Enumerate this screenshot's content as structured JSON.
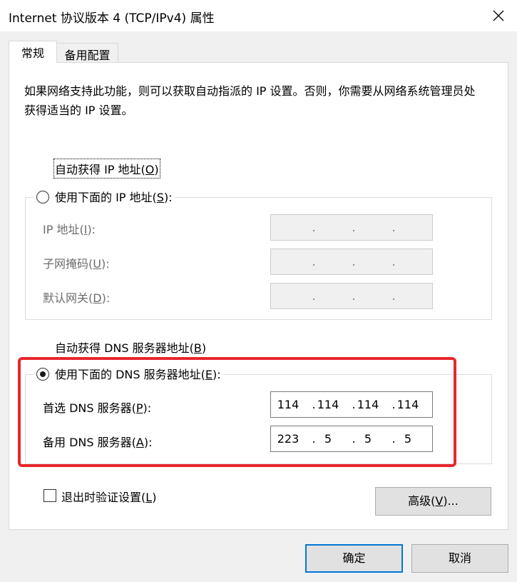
{
  "window": {
    "title": "Internet 协议版本 4 (TCP/IPv4) 属性"
  },
  "tabs": [
    {
      "label": "常规",
      "active": true
    },
    {
      "label": "备用配置",
      "active": false
    }
  ],
  "description": "如果网络支持此功能，则可以获取自动指派的 IP 设置。否则，你需要从网络系统管理员处获得适当的 IP 设置。",
  "ip_section": {
    "auto_option": {
      "label": "自动获得 IP 地址",
      "key": "O",
      "checked": true
    },
    "manual_option": {
      "label": "使用下面的 IP 地址",
      "key": "S",
      "checked": false
    },
    "fields": [
      {
        "label": "IP 地址",
        "key": "I",
        "segments": [
          "",
          "",
          "",
          ""
        ],
        "enabled": false
      },
      {
        "label": "子网掩码",
        "key": "U",
        "segments": [
          "",
          "",
          "",
          ""
        ],
        "enabled": false
      },
      {
        "label": "默认网关",
        "key": "D",
        "segments": [
          "",
          "",
          "",
          ""
        ],
        "enabled": false
      }
    ]
  },
  "dns_section": {
    "auto_option": {
      "label": "自动获得 DNS 服务器地址",
      "key": "B",
      "checked": false
    },
    "manual_option": {
      "label": "使用下面的 DNS 服务器地址",
      "key": "E",
      "checked": true
    },
    "fields": [
      {
        "label": "首选 DNS 服务器",
        "key": "P",
        "segments": [
          "114",
          "114",
          "114",
          "114"
        ],
        "enabled": true
      },
      {
        "label": "备用 DNS 服务器",
        "key": "A",
        "segments": [
          "223",
          "5",
          "5",
          "5"
        ],
        "enabled": true
      }
    ]
  },
  "validate_on_exit": {
    "label": "退出时验证设置",
    "key": "L",
    "checked": false
  },
  "buttons": {
    "advanced": {
      "label": "高级",
      "key": "V",
      "suffix": "..."
    },
    "ok": "确定",
    "cancel": "取消"
  },
  "colors": {
    "highlight": "#e8262d",
    "primary_border": "#0078d7",
    "dialog_bg": "#f0f0f0"
  }
}
